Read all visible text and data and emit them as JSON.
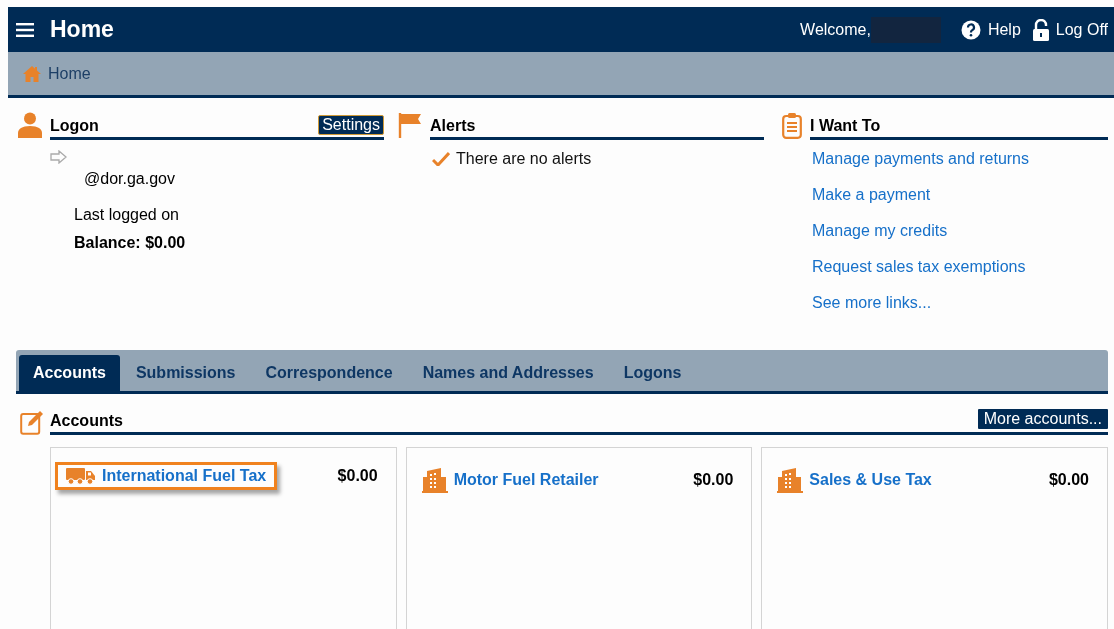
{
  "header": {
    "title": "Home",
    "welcome": "Welcome,",
    "links": [
      {
        "kind": "help",
        "label": "Help"
      },
      {
        "kind": "logoff",
        "label": "Log Off"
      }
    ]
  },
  "breadcrumb": {
    "label": "Home"
  },
  "logon": {
    "title": "Logon",
    "settings": "Settings",
    "email": "@dor.ga.gov",
    "last_logged": "Last logged on",
    "balance": "Balance: $0.00"
  },
  "alerts": {
    "title": "Alerts",
    "message": "There are no alerts"
  },
  "i_want_to": {
    "title": "I Want To",
    "links": [
      "Manage payments and returns",
      "Make a payment",
      "Manage my credits",
      "Request sales tax exemptions",
      "See more links..."
    ]
  },
  "tabs": [
    {
      "label": "Accounts",
      "selected": true
    },
    {
      "label": "Submissions",
      "selected": false
    },
    {
      "label": "Correspondence",
      "selected": false
    },
    {
      "label": "Names and Addresses",
      "selected": false
    },
    {
      "label": "Logons",
      "selected": false
    }
  ],
  "accounts": {
    "title": "Accounts",
    "more": "More accounts...",
    "cards": [
      {
        "kind": "truck",
        "name": "International Fuel Tax",
        "amount": "$0.00",
        "focused": true
      },
      {
        "kind": "building",
        "name": "Motor Fuel Retailer",
        "amount": "$0.00",
        "focused": false
      },
      {
        "kind": "building",
        "name": "Sales & Use Tax",
        "amount": "$0.00",
        "focused": false
      }
    ]
  }
}
